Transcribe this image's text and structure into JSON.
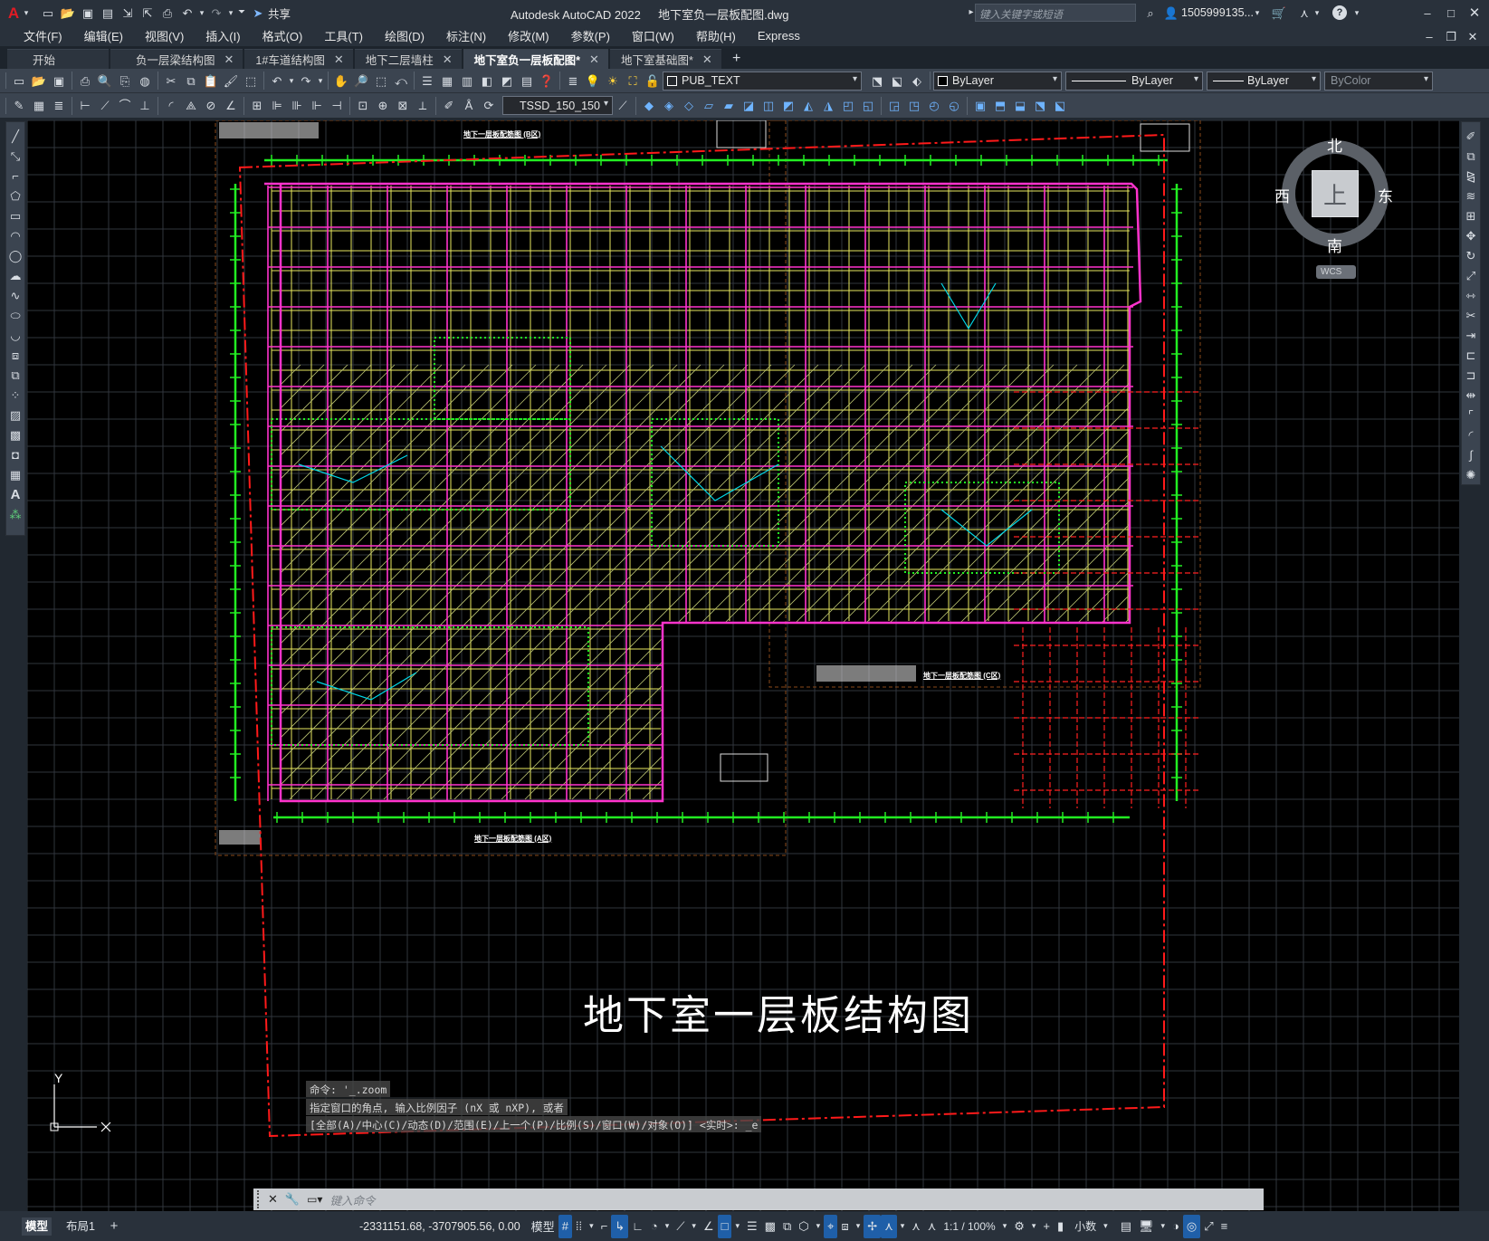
{
  "titlebar": {
    "app_title": "Autodesk AutoCAD 2022",
    "file_name": "地下室负一层板配图.dwg",
    "share_label": "共享",
    "search_placeholder": "键入关键字或短语",
    "user_name": "1505999135..."
  },
  "menu": [
    "文件(F)",
    "编辑(E)",
    "视图(V)",
    "插入(I)",
    "格式(O)",
    "工具(T)",
    "绘图(D)",
    "标注(N)",
    "修改(M)",
    "参数(P)",
    "窗口(W)",
    "帮助(H)",
    "Express"
  ],
  "tabs": [
    {
      "label": "开始",
      "closable": false,
      "active": false
    },
    {
      "label": "负一层梁结构图",
      "closable": true,
      "active": false
    },
    {
      "label": "1#车道结构图",
      "closable": true,
      "active": false
    },
    {
      "label": "地下二层墙柱",
      "closable": true,
      "active": false
    },
    {
      "label": "地下室负一层板配图*",
      "closable": true,
      "active": true
    },
    {
      "label": "地下室基础图*",
      "closable": true,
      "active": false
    }
  ],
  "toolbar1": {
    "layer_value": "PUB_TEXT",
    "color_value": "ByLayer",
    "linetype_value": "ByLayer",
    "lineweight_value": "ByLayer",
    "plotstyle_value": "ByColor"
  },
  "toolbar2": {
    "dimstyle_value": "TSSD_150_150"
  },
  "drawing": {
    "main_title": "地下室一层板结构图",
    "sub_title_top": "地下一层板配筋图 (B区)",
    "sub_title_bottom": "地下一层板配筋图 (A区)",
    "sub_title_right": "地下一层板配筋图 (C区)",
    "colors": {
      "grid": "#31363d",
      "lime": "#22ee22",
      "yellow": "#e8e860",
      "magenta": "#ff33cc",
      "red": "#ff2020",
      "cyan": "#00d8e8"
    }
  },
  "viewcube": {
    "north": "北",
    "south": "南",
    "east": "东",
    "west": "西",
    "face": "上",
    "wcs": "WCS"
  },
  "ucs": {
    "y_label": "Y"
  },
  "command": {
    "history": [
      "命令: '_.zoom",
      "指定窗口的角点, 输入比例因子 (nX 或 nXP), 或者",
      "[全部(A)/中心(C)/动态(D)/范围(E)/上一个(P)/比例(S)/窗口(W)/对象(O)] <实时>: _e"
    ],
    "placeholder": "键入命令"
  },
  "layout_tabs": [
    "模型",
    "布局1"
  ],
  "status": {
    "coordinates": "-2331151.68, -3707905.56, 0.00",
    "space": "模型",
    "scale": "1:1 / 100%",
    "units": "小数"
  }
}
